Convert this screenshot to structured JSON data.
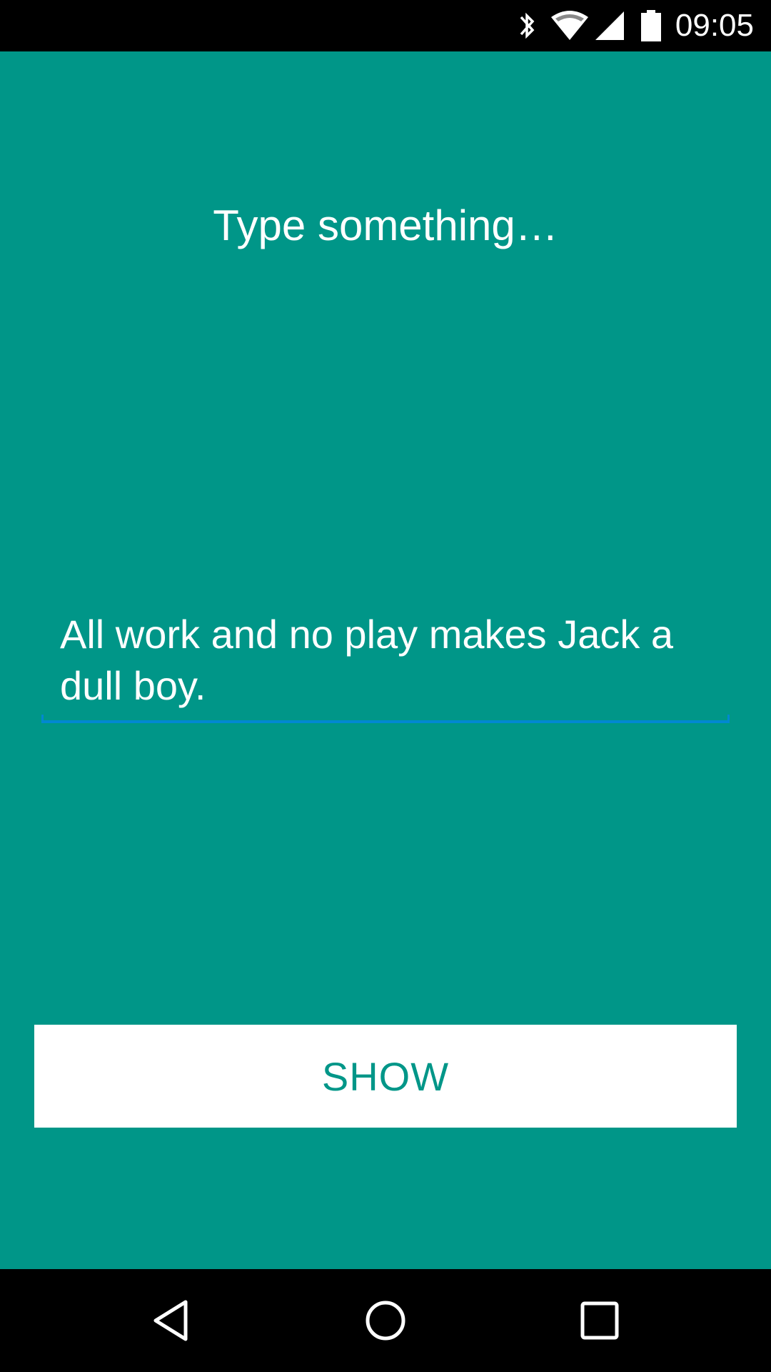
{
  "status_bar": {
    "time": "09:05",
    "icons": [
      "bluetooth-icon",
      "wifi-icon",
      "cell-signal-icon",
      "battery-icon"
    ]
  },
  "main": {
    "prompt": "Type something…",
    "input_value": "All work and no play makes Jack a dull boy.",
    "show_button_label": "SHOW"
  },
  "nav_bar": {
    "buttons": [
      "back-button",
      "home-button",
      "recents-button"
    ]
  },
  "colors": {
    "background": "#009688",
    "accent": "#0288d1",
    "button_bg": "#ffffff",
    "button_text": "#009688"
  }
}
